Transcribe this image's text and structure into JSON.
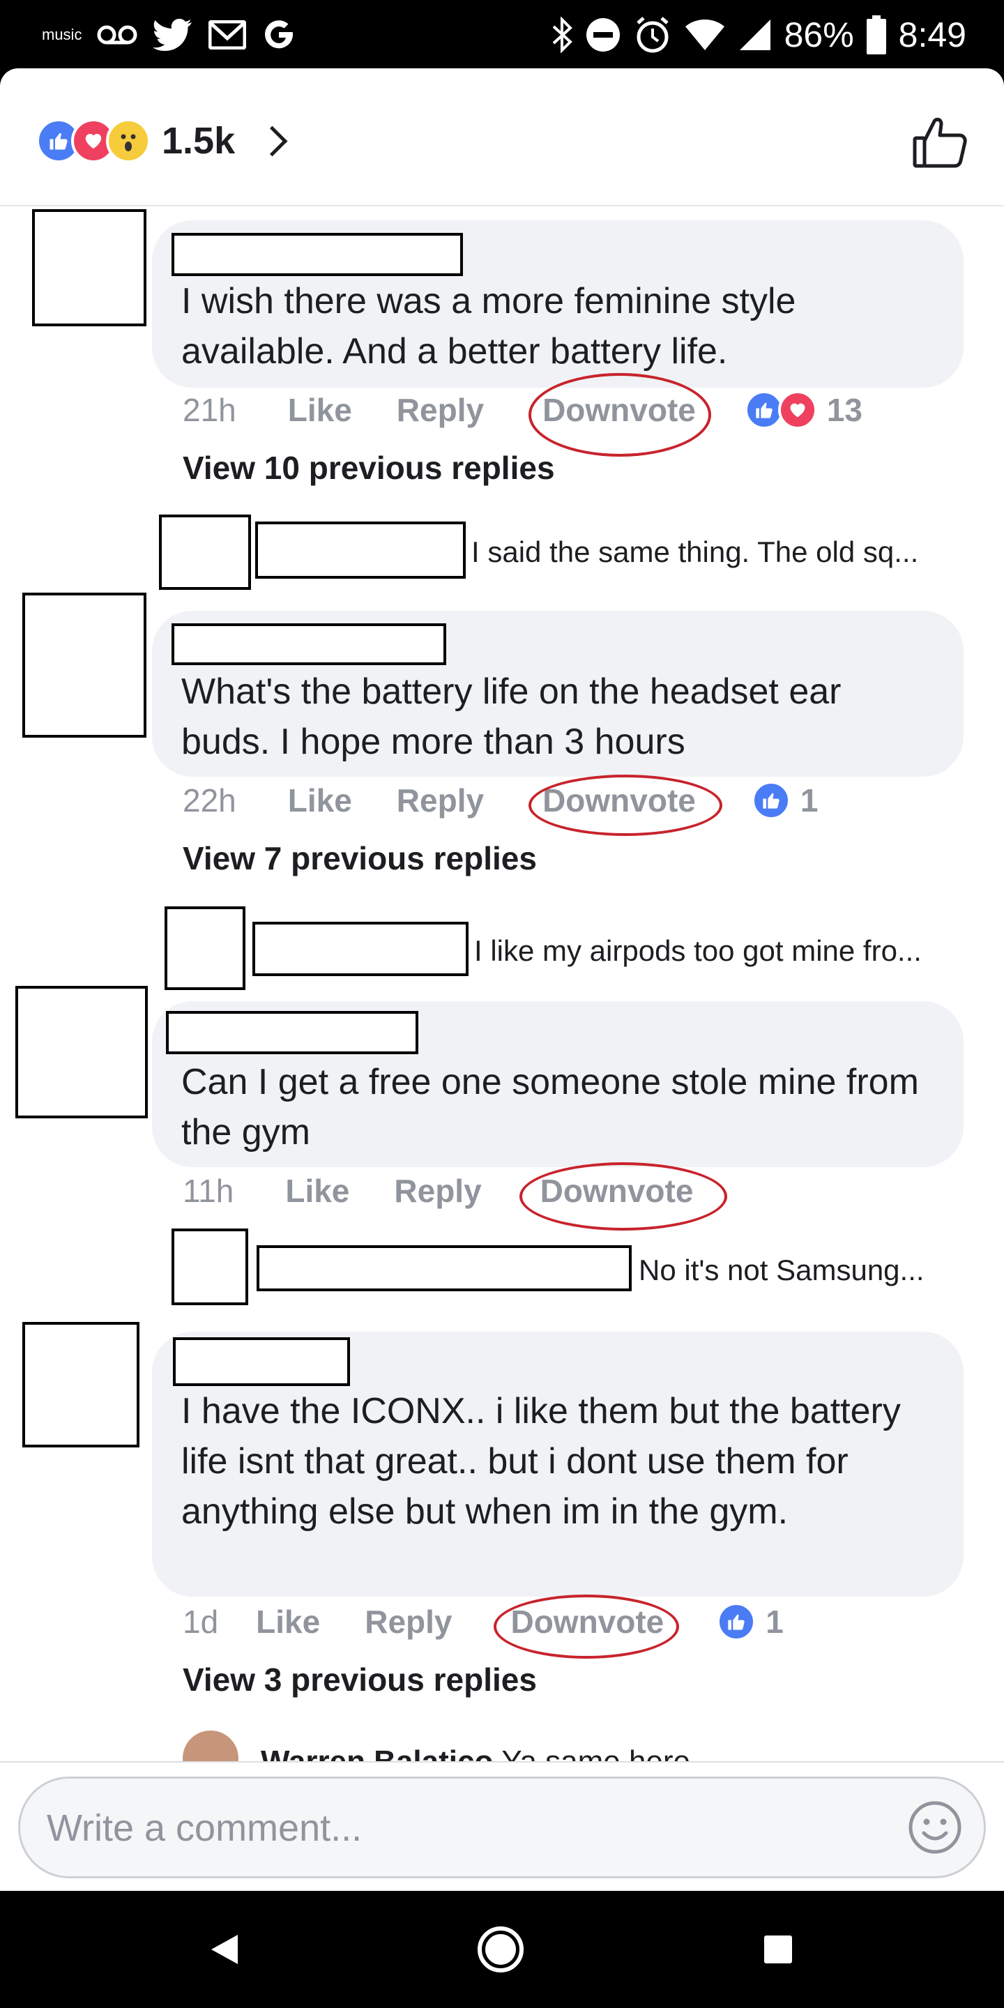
{
  "status_bar": {
    "music_label": "music",
    "battery_percent": "86%",
    "time": "8:49",
    "icons": [
      "music-icon",
      "voicemail-icon",
      "twitter-icon",
      "gmail-icon",
      "google-icon",
      "bluetooth-icon",
      "do-not-disturb-icon",
      "alarm-icon",
      "wifi-icon",
      "signal-icon",
      "battery-icon"
    ]
  },
  "header": {
    "reaction_count": "1.5k",
    "reactions": [
      "like",
      "love",
      "wow"
    ]
  },
  "comments": [
    {
      "text": "I wish there was a more feminine style available. And a better battery life.",
      "time": "21h",
      "like_label": "Like",
      "reply_label": "Reply",
      "downvote_label": "Downvote",
      "reaction_icons": [
        "like",
        "love"
      ],
      "reaction_count": "13",
      "view_replies": "View 10 previous replies",
      "reply_preview": "I said the same thing. The old sq..."
    },
    {
      "text": "What's the battery life on the headset ear buds. I hope more than 3 hours",
      "time": "22h",
      "like_label": "Like",
      "reply_label": "Reply",
      "downvote_label": "Downvote",
      "reaction_icons": [
        "like"
      ],
      "reaction_count": "1",
      "view_replies": "View 7 previous replies",
      "reply_preview": "I like my airpods too got mine fro..."
    },
    {
      "text": "Can I get a free one someone stole mine from the gym",
      "time": "11h",
      "like_label": "Like",
      "reply_label": "Reply",
      "downvote_label": "Downvote",
      "reply_preview": "No it's not Samsung..."
    },
    {
      "text": "I have the ICONX.. i like them but the battery life isnt that great.. but i dont use them for anything else but when im in the gym.",
      "time": "1d",
      "like_label": "Like",
      "reply_label": "Reply",
      "downvote_label": "Downvote",
      "reaction_icons": [
        "like"
      ],
      "reaction_count": "1",
      "view_replies": "View 3 previous replies",
      "partial_reply_name": "Warren Balatico",
      "partial_reply_text": "Ya same here"
    }
  ],
  "composer": {
    "placeholder": "Write a comment..."
  },
  "colors": {
    "facebook_blue": "#4a7cf6",
    "love_red": "#f0405f",
    "annotation_red": "#c8232c",
    "muted_gray": "#90949c",
    "bubble_gray": "#f0f2f5"
  }
}
